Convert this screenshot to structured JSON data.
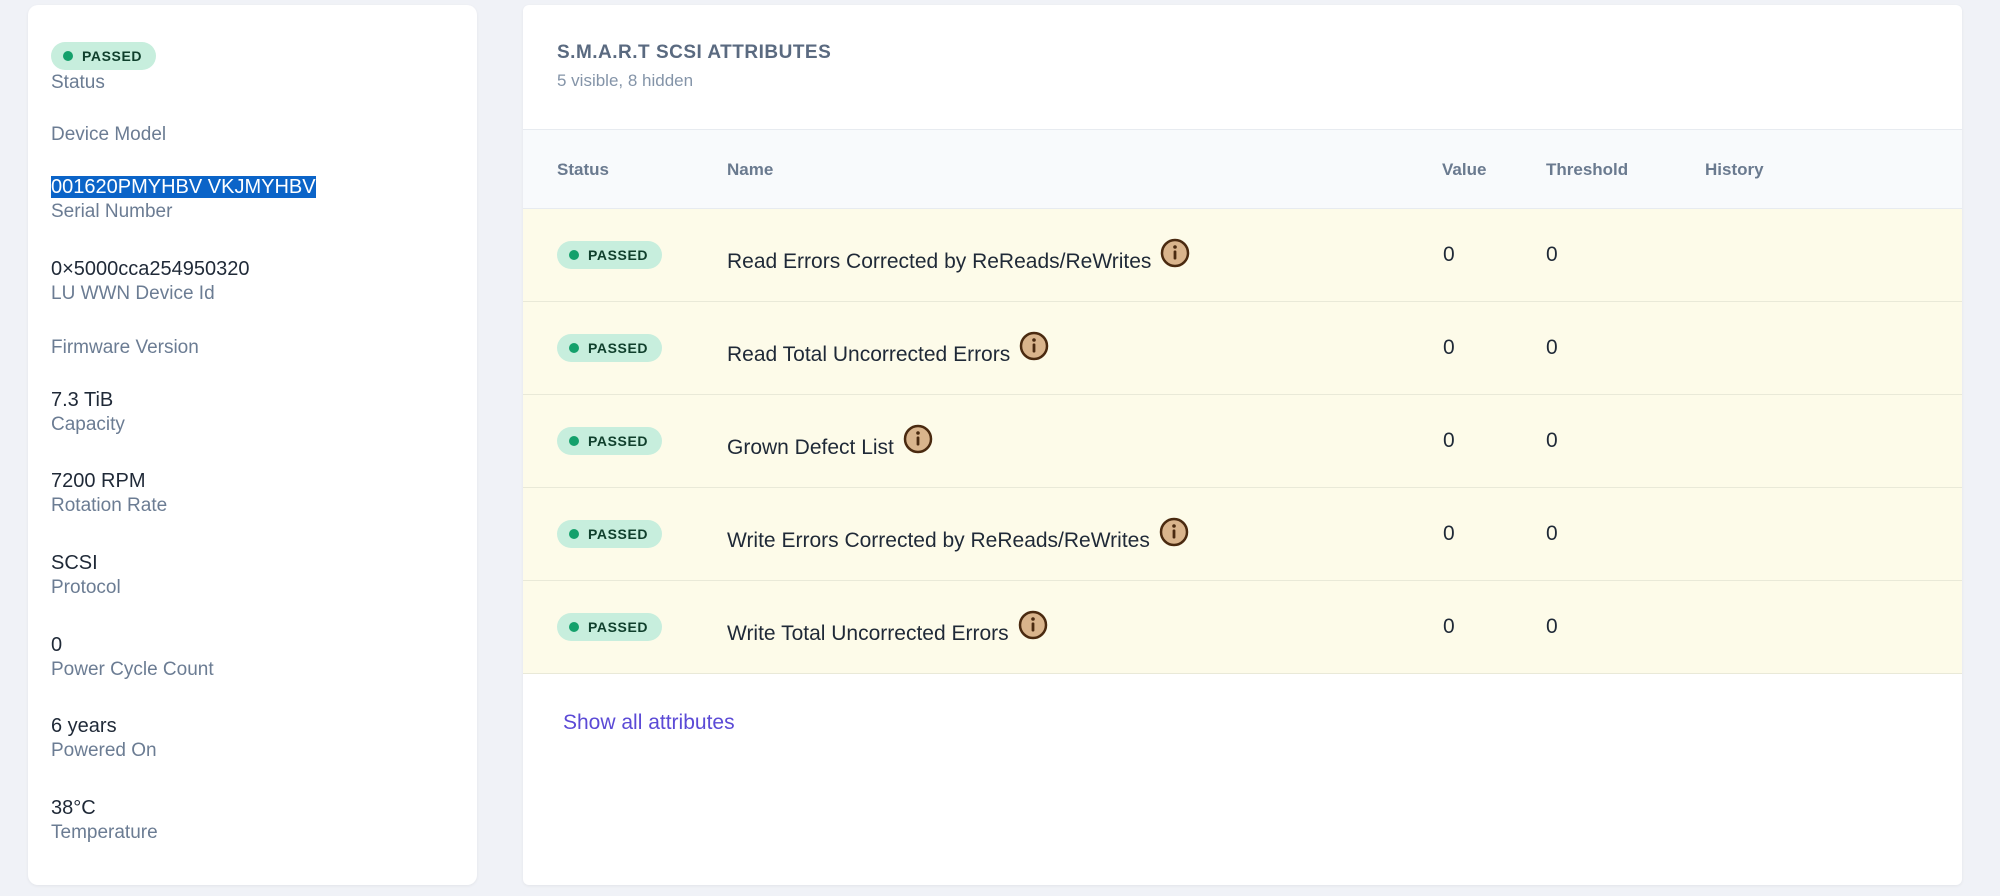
{
  "device": {
    "status_badge": "PASSED",
    "status_label": "Status",
    "model_label": "Device Model",
    "serial_value": "001620PMYHBV VKJMYHBV",
    "serial_label": "Serial Number",
    "wwn_value": "0×5000cca254950320",
    "wwn_label": "LU WWN Device Id",
    "firmware_label": "Firmware Version",
    "capacity_value": "7.3 TiB",
    "capacity_label": "Capacity",
    "rotation_value": "7200 RPM",
    "rotation_label": "Rotation Rate",
    "protocol_value": "SCSI",
    "protocol_label": "Protocol",
    "power_cycle_value": "0",
    "power_cycle_label": "Power Cycle Count",
    "powered_on_value": "6 years",
    "powered_on_label": "Powered On",
    "temperature_value": "38°C",
    "temperature_label": "Temperature"
  },
  "attributes": {
    "title": "S.M.A.R.T SCSI ATTRIBUTES",
    "subtitle": "5 visible, 8 hidden",
    "columns": {
      "status": "Status",
      "name": "Name",
      "value": "Value",
      "threshold": "Threshold",
      "history": "History"
    },
    "rows": [
      {
        "status": "PASSED",
        "name": "Read Errors Corrected by ReReads/ReWrites",
        "value": "0",
        "threshold": "0"
      },
      {
        "status": "PASSED",
        "name": "Read Total Uncorrected Errors",
        "value": "0",
        "threshold": "0"
      },
      {
        "status": "PASSED",
        "name": "Grown Defect List",
        "value": "0",
        "threshold": "0"
      },
      {
        "status": "PASSED",
        "name": "Write Errors Corrected by ReReads/ReWrites",
        "value": "0",
        "threshold": "0"
      },
      {
        "status": "PASSED",
        "name": "Write Total Uncorrected Errors",
        "value": "0",
        "threshold": "0"
      }
    ],
    "show_all_label": "Show all attributes"
  },
  "colors": {
    "passed_badge_bg": "#c7eedd",
    "passed_dot": "#14a06b",
    "row_highlight": "#fdfbe9",
    "link": "#5b4ad6",
    "info_icon_fill": "#d9b48c",
    "info_icon_stroke": "#4a2a10"
  }
}
